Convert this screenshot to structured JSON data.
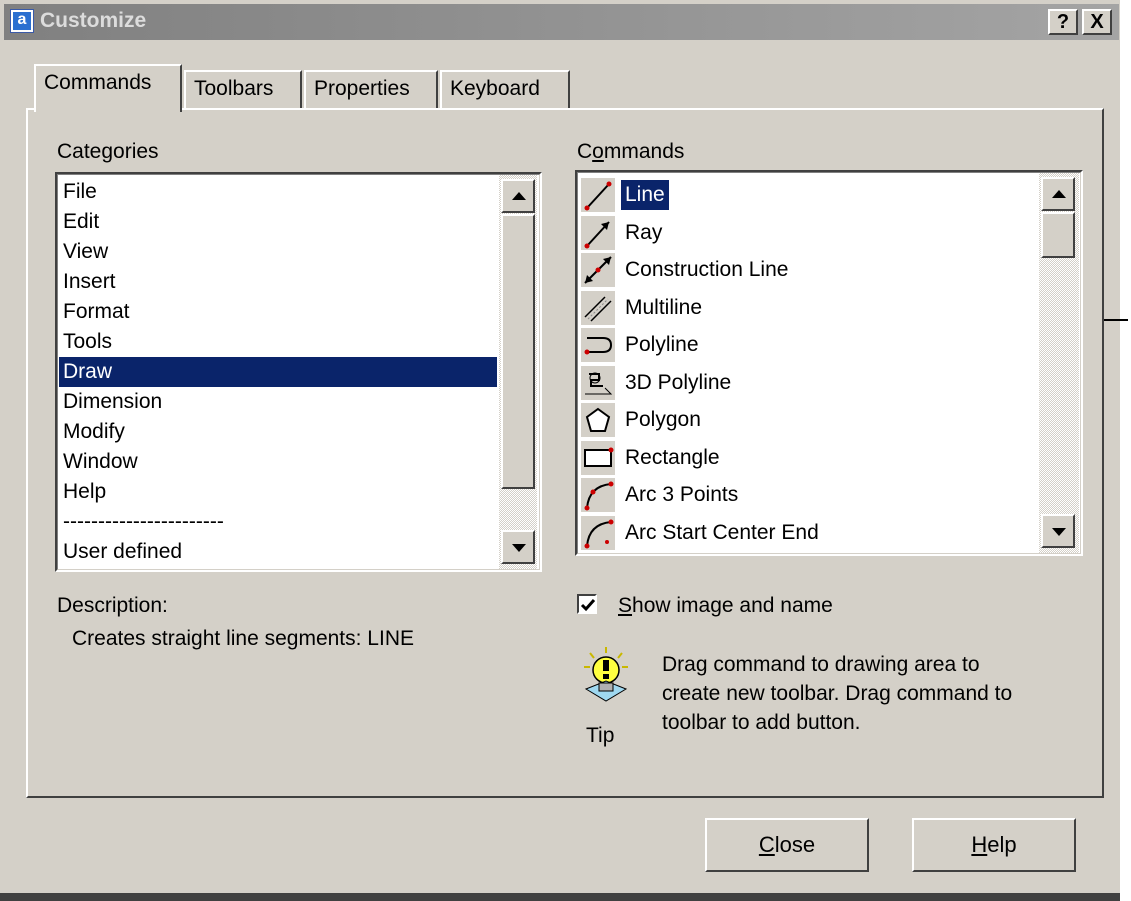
{
  "window": {
    "title": "Customize",
    "app_icon_letter": "a",
    "help_caption": "?",
    "close_caption": "X"
  },
  "tabs": [
    {
      "label": "Commands",
      "active": true
    },
    {
      "label": "Toolbars",
      "active": false
    },
    {
      "label": "Properties",
      "active": false
    },
    {
      "label": "Keyboard",
      "active": false
    }
  ],
  "categories": {
    "label": "Categories",
    "items": [
      "File",
      "Edit",
      "View",
      "Insert",
      "Format",
      "Tools",
      "Draw",
      "Dimension",
      "Modify",
      "Window",
      "Help",
      "-----------------------",
      "User defined"
    ],
    "selected": "Draw"
  },
  "commands": {
    "label_prefix": "C",
    "label_underlined": "o",
    "label_rest": "mmands",
    "items": [
      {
        "label": "Line",
        "icon": "line-icon",
        "selected": true
      },
      {
        "label": "Ray",
        "icon": "ray-icon"
      },
      {
        "label": "Construction Line",
        "icon": "construction-line-icon"
      },
      {
        "label": "Multiline",
        "icon": "multiline-icon"
      },
      {
        "label": "Polyline",
        "icon": "polyline-icon"
      },
      {
        "label": "3D Polyline",
        "icon": "3d-polyline-icon"
      },
      {
        "label": "Polygon",
        "icon": "polygon-icon"
      },
      {
        "label": "Rectangle",
        "icon": "rectangle-icon"
      },
      {
        "label": "Arc 3 Points",
        "icon": "arc-3-points-icon"
      },
      {
        "label": "Arc Start Center End",
        "icon": "arc-start-center-end-icon"
      }
    ]
  },
  "description": {
    "label": "Description:",
    "text": "Creates straight line segments:  LINE"
  },
  "show_image": {
    "checked": true,
    "mnemonic": "S",
    "label_rest": "how image and name"
  },
  "tip": {
    "caption": "Tip",
    "lines": [
      "Drag command to drawing area to",
      "create new toolbar. Drag command to",
      "toolbar to add button."
    ]
  },
  "buttons": {
    "close_mnemonic": "C",
    "close_rest": "lose",
    "help_mnemonic": "H",
    "help_rest": "elp"
  },
  "colors": {
    "dialog_face": "#d4d0c8",
    "selection": "#0a246a",
    "title_bar": "#808080"
  }
}
